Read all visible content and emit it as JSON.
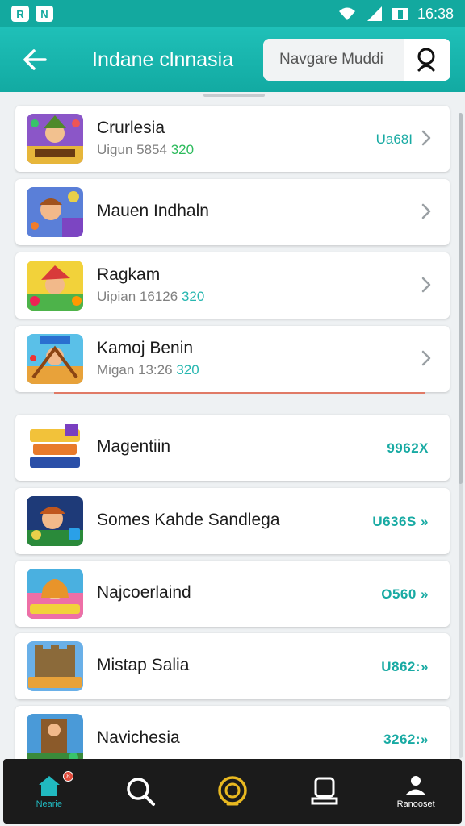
{
  "status_bar": {
    "badges": [
      "R",
      "N"
    ],
    "time": "16:38"
  },
  "app_bar": {
    "title": "Indane clnnasia",
    "search_placeholder": "Navgare Muddi"
  },
  "games": [
    {
      "name": "Crurlesia",
      "sub_prefix": "Uigun 5854",
      "sub_accent": "320",
      "sub_accent_color": "green",
      "value": "Ua68I",
      "chevron": true,
      "icon": "game-icon-warrior"
    },
    {
      "name": "Mauen Indhaln",
      "chevron": true,
      "icon": "game-icon-hero"
    },
    {
      "name": "Ragkam",
      "sub_prefix": "Uipian 16126",
      "sub_accent": "320",
      "sub_accent_color": "teal",
      "chevron": true,
      "icon": "game-icon-pirate"
    },
    {
      "name": "Kamoj Benin",
      "sub_prefix": "Migan 13:26",
      "sub_accent": "320",
      "sub_accent_color": "teal",
      "chevron": true,
      "icon": "game-icon-adventure",
      "accent_line": true
    },
    {
      "name": "Magentiin",
      "value": "9962X",
      "icon": "game-icon-logo"
    },
    {
      "name": "Somes Kahde Sandlega",
      "value": "U636S »",
      "icon": "game-icon-knight"
    },
    {
      "name": "Najcoerlaind",
      "value": "O560 »",
      "icon": "game-icon-girl"
    },
    {
      "name": "Mistap Salia",
      "value": "U862:»",
      "icon": "game-icon-castle"
    },
    {
      "name": "Navichesia",
      "value": "3262:»",
      "icon": "game-icon-tower"
    }
  ],
  "bottom_nav": [
    {
      "label": "Nearie",
      "icon": "home-icon",
      "active": true,
      "badge": "8"
    },
    {
      "label": "",
      "icon": "search-icon"
    },
    {
      "label": "",
      "icon": "coin-icon"
    },
    {
      "label": "",
      "icon": "profile-card-icon"
    },
    {
      "label": "Ranooset",
      "icon": "user-icon"
    }
  ],
  "colors": {
    "accent": "#13a99f",
    "value_text": "#18aaa3",
    "nav_bg": "#1b1b1b"
  }
}
